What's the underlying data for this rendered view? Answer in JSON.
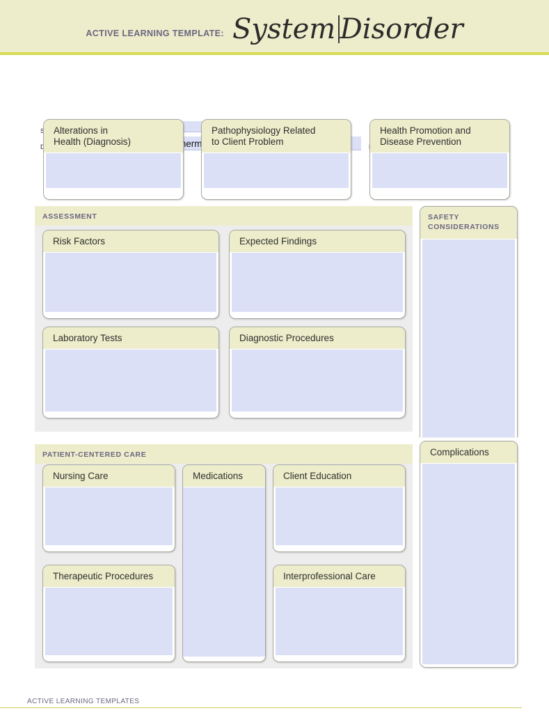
{
  "header": {
    "eyebrow": "ACTIVE LEARNING TEMPLATE:",
    "title_part1": "System",
    "title_part2": "Disorder",
    "banner_color": "#ededcb",
    "banner_rule_color": "#d6da52"
  },
  "meta": {
    "student_name_label": "STUDENT NAME",
    "student_name_value": "",
    "disorder_label": "DISORDER/DISEASE PROCESS",
    "disorder_value": "Hyperthermia",
    "review_label": "REVIEW MODULE CHAPTER",
    "review_value": "",
    "field_fill_color": "#dce0f7"
  },
  "top_row": [
    {
      "title": "Alterations in\nHealth (Diagnosis)",
      "value": ""
    },
    {
      "title": "Pathophysiology Related\nto Client Problem",
      "value": ""
    },
    {
      "title": "Health Promotion and\nDisease Prevention",
      "value": ""
    }
  ],
  "assessment": {
    "section_label": "ASSESSMENT",
    "cards": [
      {
        "title": "Risk Factors",
        "value": ""
      },
      {
        "title": "Expected Findings",
        "value": ""
      },
      {
        "title": "Laboratory Tests",
        "value": ""
      },
      {
        "title": "Diagnostic Procedures",
        "value": ""
      }
    ]
  },
  "safety": {
    "section_label": "SAFETY\nCONSIDERATIONS",
    "value": ""
  },
  "complications": {
    "title": "Complications",
    "value": ""
  },
  "patient_centered_care": {
    "section_label": "PATIENT-CENTERED CARE",
    "cards": [
      {
        "title": "Nursing Care",
        "value": ""
      },
      {
        "title": "Medications",
        "value": ""
      },
      {
        "title": "Client Education",
        "value": ""
      },
      {
        "title": "Therapeutic Procedures",
        "value": ""
      },
      {
        "title": "Interprofessional Care",
        "value": ""
      }
    ]
  },
  "footer": {
    "text": "ACTIVE LEARNING TEMPLATES",
    "rule_color": "#c9cc5e"
  }
}
